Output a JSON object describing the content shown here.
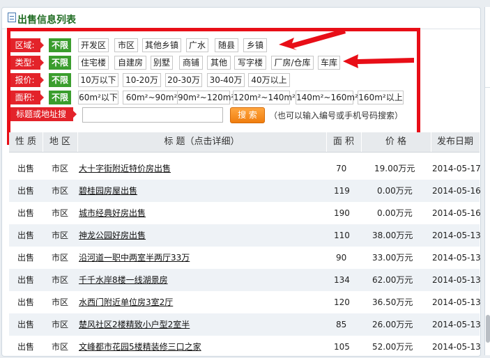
{
  "panel": {
    "title": "出售信息列表"
  },
  "filters": {
    "rows": [
      {
        "label": "区域:",
        "all": "不限",
        "options": [
          "开发区",
          "市区",
          "其他乡镇",
          "广水",
          "随县",
          "乡镇"
        ]
      },
      {
        "label": "类型:",
        "all": "不限",
        "options": [
          "住宅楼",
          "自建房",
          "别墅",
          "商铺",
          "其他",
          "写字楼",
          "厂房/仓库",
          "车库"
        ]
      },
      {
        "label": "报价:",
        "all": "不限",
        "options": [
          "10万以下",
          "10-20万",
          "20-30万",
          "30-40万",
          "40万以上"
        ]
      },
      {
        "label": "面积:",
        "all": "不限",
        "options": [
          "60m²以下",
          "60m²~90m²",
          "90m²~120m²",
          "120m²~140m²",
          "140m²~160m²",
          "160m²以上"
        ]
      }
    ],
    "keyword": {
      "label": "标题或地址搜",
      "value": "",
      "button": "搜 索",
      "hint": "（也可以输入编号或手机号码搜索）"
    }
  },
  "table": {
    "headers": [
      "性 质",
      "地 区",
      "标 题（点击详细）",
      "面 积",
      "价 格",
      "发布日期"
    ],
    "rows": [
      {
        "type": "出售",
        "area": "市区",
        "title": "大十字街附近特价房出售",
        "size": "70",
        "price": "19.00万元",
        "date": "2014-05-17"
      },
      {
        "type": "出售",
        "area": "市区",
        "title": "碧桂园房屋出售",
        "size": "119",
        "price": "0.00万元",
        "date": "2014-05-16"
      },
      {
        "type": "出售",
        "area": "市区",
        "title": "城市经典好房出售",
        "size": "190",
        "price": "0.00万元",
        "date": "2014-05-16"
      },
      {
        "type": "出售",
        "area": "市区",
        "title": "神龙公园好房出售",
        "size": "110",
        "price": "38.00万元",
        "date": "2014-05-13"
      },
      {
        "type": "出售",
        "area": "市区",
        "title": "沿河道一职中两室半两厅33万",
        "size": "90",
        "price": "33.00万元",
        "date": "2014-05-13"
      },
      {
        "type": "出售",
        "area": "市区",
        "title": "千千水岸8楼一线湖景房",
        "size": "134",
        "price": "62.00万元",
        "date": "2014-05-13"
      },
      {
        "type": "出售",
        "area": "市区",
        "title": "水西门附近单位房3室2厅",
        "size": "120",
        "price": "36.50万元",
        "date": "2014-05-13"
      },
      {
        "type": "出售",
        "area": "市区",
        "title": "楚风社区2楼精致小户型2室半",
        "size": "85",
        "price": "26.00万元",
        "date": "2014-05-13"
      },
      {
        "type": "出售",
        "area": "市区",
        "title": "文峰都市花园5楼精装修三口之家",
        "size": "105",
        "price": "52.00万元",
        "date": "2014-05-13"
      }
    ]
  },
  "colors": {
    "highlight_border": "#e80e17",
    "label_red": "#e3232a",
    "all_green": "#3a9d2d",
    "search_orange": "#f07d0e",
    "title_green": "#1f6c22"
  }
}
